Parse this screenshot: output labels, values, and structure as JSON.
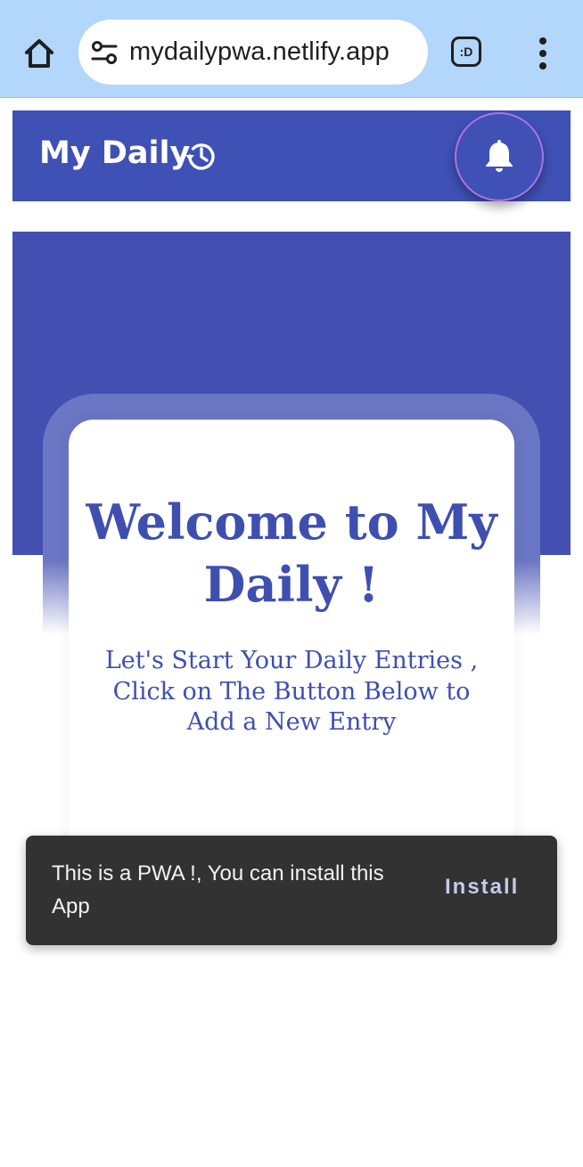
{
  "browser": {
    "url": "mydailypwa.netlify.app",
    "tab_switcher_label": ":D"
  },
  "app_bar": {
    "title": "My Daily"
  },
  "hero": {
    "title": "Welcome to My Daily !",
    "subtitle": "Let's Start Your Daily Entries , Click on The Button Below to Add a New Entry"
  },
  "snackbar": {
    "message": "This is a PWA !, You can install this App",
    "action_label": "Install"
  },
  "icons": {
    "home": "home-icon",
    "site_settings": "tune-icon",
    "menu": "more-vert-icon",
    "history": "history-icon",
    "notifications": "bell-icon"
  },
  "colors": {
    "browser_bar": "#b3d6fb",
    "primary": "#3f51b5",
    "hero_text": "#3f4fb0",
    "snackbar_bg": "#323232",
    "snackbar_action": "#c5cae9",
    "fab_ring": "#b071e6"
  }
}
